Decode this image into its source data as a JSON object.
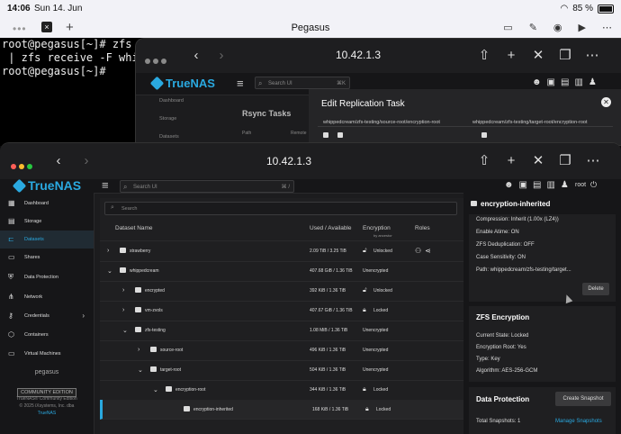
{
  "status_bar": {
    "time": "14:06",
    "date": "Sun 14. Jun",
    "battery": "85 %",
    "battery_level": 0.85
  },
  "terminal_tab": {
    "title": "Pegasus",
    "close_label": "×",
    "new_label": "+"
  },
  "terminal": {
    "lines": [
      "root@pegasus[~]# zfs se",
      " | zfs receive -F whipp",
      "root@pegasus[~]# "
    ]
  },
  "back_window": {
    "url": "10.42.1.3",
    "brand": "TrueNAS",
    "search_placeholder": "Search UI",
    "search_shortcut": "⌘K",
    "sidebar": [
      "Dashboard",
      "Storage",
      "Datasets"
    ],
    "page_title": "Rsync Tasks",
    "columns": [
      "Path",
      "Remote"
    ],
    "dialog": {
      "title": "Edit Replication Task",
      "source_path": "whippedcream/zfs-testing/source-root/encryption-root",
      "target_path": "whippedcream/zfs-testing/target-root/encryption-root"
    }
  },
  "front_window": {
    "url": "10.42.1.3",
    "brand": "TrueNAS",
    "search_placeholder": "Search UI",
    "search_shortcut": "⌘ /",
    "user": "root",
    "sidebar": {
      "items": [
        {
          "label": "Dashboard",
          "icon": "dashboard-icon",
          "active": false
        },
        {
          "label": "Storage",
          "icon": "storage-icon",
          "active": false
        },
        {
          "label": "Datasets",
          "icon": "datasets-icon",
          "active": true
        },
        {
          "label": "Shares",
          "icon": "shares-icon",
          "active": false
        },
        {
          "label": "Data Protection",
          "icon": "shield-icon",
          "active": false
        },
        {
          "label": "Network",
          "icon": "network-icon",
          "active": false
        },
        {
          "label": "Credentials",
          "icon": "key-icon",
          "active": false
        },
        {
          "label": "Containers",
          "icon": "container-icon",
          "active": false
        },
        {
          "label": "Virtual Machines",
          "icon": "monitor-icon",
          "active": false
        }
      ],
      "hostname": "pegasus",
      "edition": "COMMUNITY EDITION",
      "copyright_1": "TrueNAS® Community Edition",
      "copyright_2": "© 2025 iXsystems, Inc. dba",
      "copyright_3": "TrueNAS"
    },
    "table": {
      "search_placeholder": "Search",
      "headers": {
        "name": "Dataset Name",
        "used": "Used / Available",
        "encryption": "Encryption",
        "roles": "Roles"
      },
      "partial_row_text": "by ancestor",
      "rows": [
        {
          "name": "strawberry",
          "indent": 0,
          "chevron": "›",
          "used": "2.09 TiB / 3.25 TiB",
          "enc_icon": "unlocked-icon",
          "enc": "Unlocked",
          "roles": true
        },
        {
          "name": "whippedcream",
          "indent": 0,
          "chevron": "⌄",
          "used": "407.68 GiB / 1.36 TiB",
          "enc_icon": "",
          "enc": "Unencrypted",
          "roles": false
        },
        {
          "name": "encrypted",
          "indent": 1,
          "chevron": "›",
          "used": "392 KiB / 1.36 TiB",
          "enc_icon": "unlocked-icon",
          "enc": "Unlocked",
          "roles": false
        },
        {
          "name": "vm-zvols",
          "indent": 1,
          "chevron": "›",
          "used": "407.67 GiB / 1.36 TiB",
          "enc_icon": "locked-icon",
          "enc": "Locked",
          "roles": false
        },
        {
          "name": "zfs-testing",
          "indent": 1,
          "chevron": "⌄",
          "used": "1.08 MiB / 1.36 TiB",
          "enc_icon": "",
          "enc": "Unencrypted",
          "roles": false
        },
        {
          "name": "source-root",
          "indent": 2,
          "chevron": "›",
          "used": "496 KiB / 1.36 TiB",
          "enc_icon": "",
          "enc": "Unencrypted",
          "roles": false
        },
        {
          "name": "target-root",
          "indent": 2,
          "chevron": "⌄",
          "used": "504 KiB / 1.36 TiB",
          "enc_icon": "",
          "enc": "Unencrypted",
          "roles": false
        },
        {
          "name": "encryption-root",
          "indent": 3,
          "chevron": "⌄",
          "used": "344 KiB / 1.36 TiB",
          "enc_icon": "locked-icon",
          "enc": "Locked",
          "roles": false
        },
        {
          "name": "encryption-inherited",
          "indent": 4,
          "chevron": "",
          "used": "168 KiB / 1.36 TiB",
          "enc_icon": "locked-icon",
          "enc": "Locked",
          "roles": false,
          "selected": true
        }
      ]
    },
    "details": {
      "title": "encryption-inherited",
      "general": [
        "Compression: Inherit (1.00x (LZ4))",
        "Enable Atime: ON",
        "ZFS Deduplication: OFF",
        "Case Sensitivity: ON",
        "Path: whippedcream/zfs-testing/target..."
      ],
      "delete_label": "Delete",
      "encryption": {
        "title": "ZFS Encryption",
        "lines": [
          "Current State: Locked",
          "Encryption Root: Yes",
          "Type: Key",
          "Algorithm: AES-256-GCM"
        ]
      },
      "protection": {
        "title": "Data Protection",
        "snapshot_button": "Create Snapshot",
        "total": "Total Snapshots: 1",
        "manage": "Manage Snapshots"
      }
    }
  },
  "colors": {
    "accent": "#2aa9e0",
    "bg": "#1c1c1e",
    "panel": "#1f1f21"
  }
}
